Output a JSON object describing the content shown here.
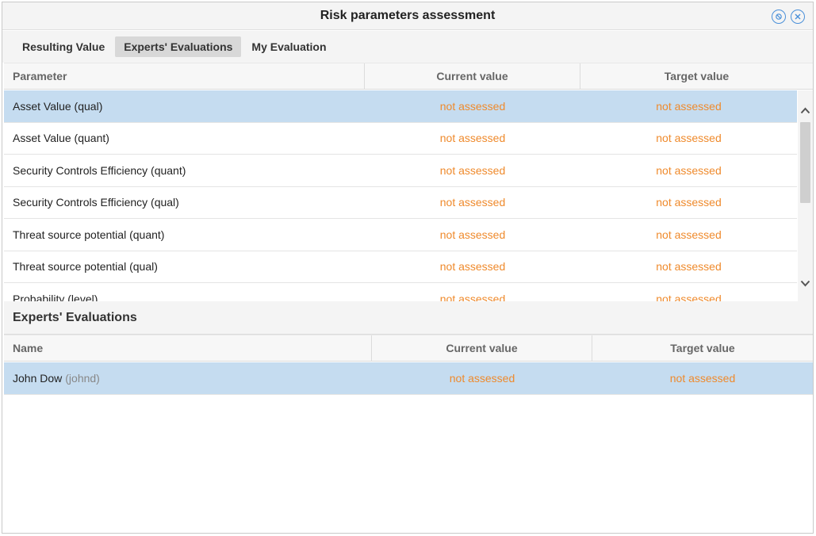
{
  "window": {
    "title": "Risk parameters assessment"
  },
  "tabs": [
    {
      "label": "Resulting Value",
      "active": false
    },
    {
      "label": "Experts' Evaluations",
      "active": true
    },
    {
      "label": "My Evaluation",
      "active": false
    }
  ],
  "parameters_table": {
    "columns": [
      "Parameter",
      "Current value",
      "Target value"
    ],
    "rows": [
      {
        "name": "Asset Value (qual)",
        "current": "not assessed",
        "target": "not assessed",
        "selected": true
      },
      {
        "name": "Asset Value (quant)",
        "current": "not assessed",
        "target": "not assessed"
      },
      {
        "name": "Security Controls Efficiency (quant)",
        "current": "not assessed",
        "target": "not assessed"
      },
      {
        "name": "Security Controls Efficiency (qual)",
        "current": "not assessed",
        "target": "not assessed"
      },
      {
        "name": "Threat source potential (quant)",
        "current": "not assessed",
        "target": "not assessed"
      },
      {
        "name": "Threat source potential (qual)",
        "current": "not assessed",
        "target": "not assessed"
      },
      {
        "name": "Probability (level)",
        "current": "not assessed",
        "target": "not assessed"
      }
    ]
  },
  "experts_section": {
    "title": "Experts' Evaluations",
    "columns": [
      "Name",
      "Current value",
      "Target value"
    ],
    "rows": [
      {
        "name": "John Dow",
        "login": "(johnd)",
        "current": "not assessed",
        "target": "not assessed",
        "selected": true
      }
    ]
  },
  "colors": {
    "accent": "#4a90d9",
    "selected_row": "#c5dcf0",
    "status_text": "#ef8a2c"
  },
  "icons": [
    "settings-circle-icon",
    "close-circle-icon",
    "chevron-up-icon",
    "chevron-down-icon"
  ]
}
